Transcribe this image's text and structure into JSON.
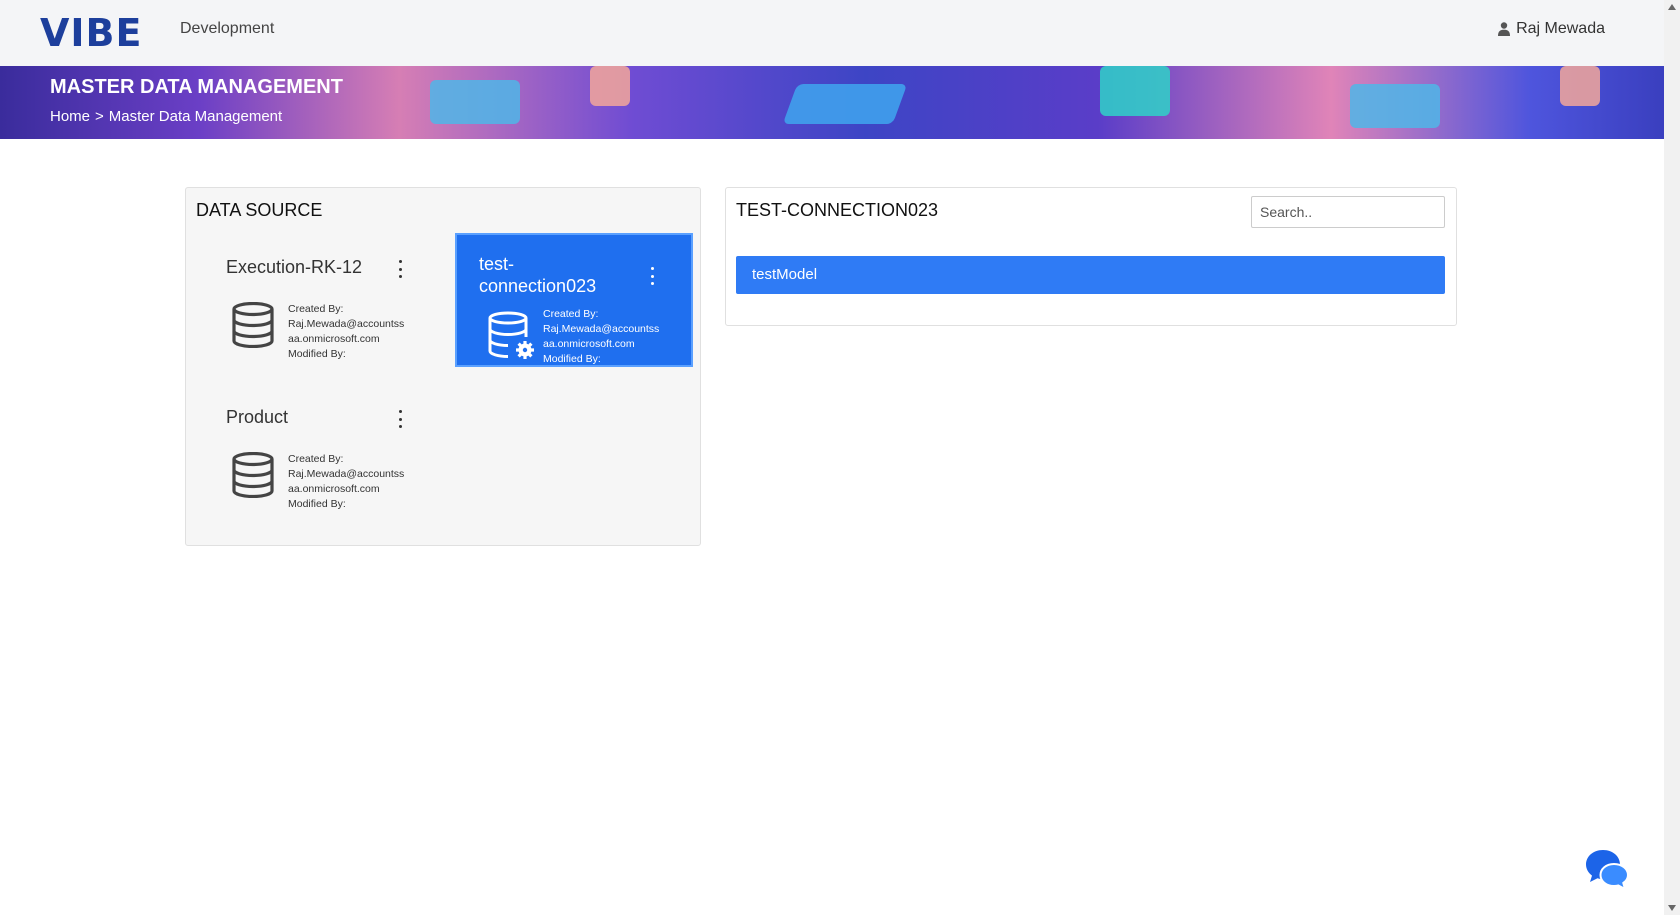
{
  "app": {
    "logo_text": "VIBE",
    "environment": "Development",
    "user_name": "Raj Mewada"
  },
  "banner": {
    "title": "MASTER DATA MANAGEMENT",
    "breadcrumb": [
      "Home",
      ">",
      "Master Data Management"
    ]
  },
  "data_source": {
    "title": "DATA SOURCE",
    "cards": [
      {
        "name": "Execution-RK-12",
        "created_by_label": "Created By:",
        "created_by_line1": "Raj.Mewada@accountss",
        "created_by_line2": "aa.onmicrosoft.com",
        "modified_by_label": "Modified By:",
        "icon": "database-icon",
        "selected": false
      },
      {
        "name": "test-connection023",
        "created_by_label": "Created By:",
        "created_by_line1": "Raj.Mewada@accountss",
        "created_by_line2": "aa.onmicrosoft.com",
        "modified_by_label": "Modified By:",
        "icon": "database-settings-icon",
        "selected": true
      },
      {
        "name": "Product",
        "created_by_label": "Created By:",
        "created_by_line1": "Raj.Mewada@accountss",
        "created_by_line2": "aa.onmicrosoft.com",
        "modified_by_label": "Modified By:",
        "icon": "database-icon",
        "selected": false
      }
    ]
  },
  "models": {
    "title": "TEST-CONNECTION023",
    "search_placeholder": "Search..",
    "items": [
      "testModel"
    ]
  },
  "colors": {
    "accent": "#1f6fef",
    "model_item": "#2f7bf5",
    "logo": "#1d3f9c"
  }
}
